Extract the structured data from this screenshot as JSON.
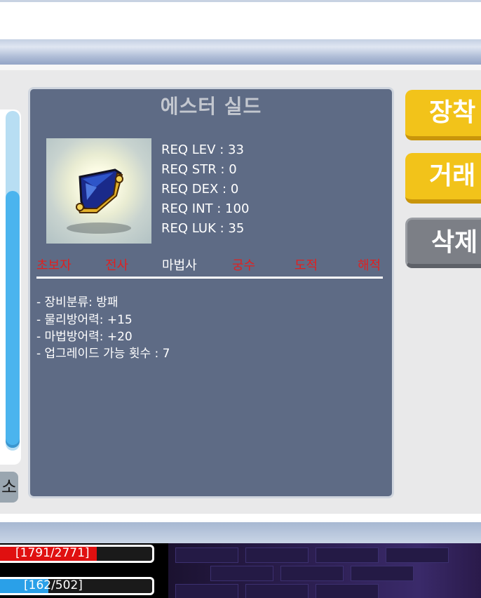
{
  "item": {
    "name": "에스터 실드",
    "requirements": [
      "REQ LEV : 33",
      "REQ STR : 0",
      "REQ DEX : 0",
      "REQ INT : 100",
      "REQ LUK : 35"
    ],
    "jobs": [
      {
        "label": "초보자",
        "allowed": false
      },
      {
        "label": "전사",
        "allowed": false
      },
      {
        "label": "마법사",
        "allowed": true
      },
      {
        "label": "궁수",
        "allowed": false
      },
      {
        "label": "도적",
        "allowed": false
      },
      {
        "label": "해적",
        "allowed": false
      }
    ],
    "stats": [
      "- 장비분류: 방패",
      "- 물리방어력: +15",
      "- 마법방어력: +20",
      "- 업그레이드 가능 횟수 : 7"
    ],
    "icon": "shield-icon"
  },
  "actions": {
    "equip": "장착",
    "trade": "거래",
    "delete": "삭제"
  },
  "left_panel": {
    "button_label": "소",
    "scroll_position": 0.24
  },
  "hud": {
    "hp": {
      "text": "[1791/2771]",
      "current": 1791,
      "max": 2771
    },
    "mp": {
      "text": "[162/502]",
      "current": 162,
      "max": 502
    }
  },
  "colors": {
    "card_bg": "#5e6b85",
    "job_denied": "#e02020",
    "job_allowed": "#ffffff",
    "button_yellow": "#f2c31a",
    "button_gray": "#7c7f86",
    "hp": "#e01010",
    "mp": "#2aa0e8"
  }
}
